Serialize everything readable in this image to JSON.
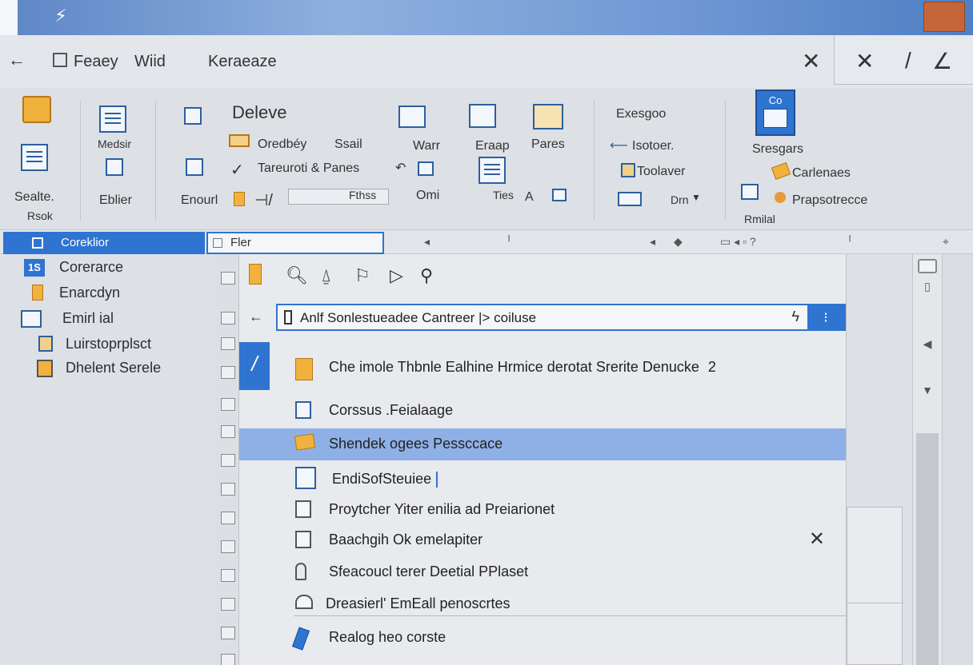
{
  "menu": {
    "items": [
      "Feaey",
      "Wiid",
      "Keraeaze"
    ]
  },
  "ribbon": {
    "group1": {
      "label1": "Sealte.",
      "label2": "Rsok"
    },
    "group2": {
      "label1": "Medsir",
      "label2": "Eblier"
    },
    "group3": {
      "title": "Deleve",
      "row1": "Oredbéy",
      "row1b": "Ssail",
      "row2": "Tareuroti & Panes",
      "row3a": "Enourl",
      "row3b": "Fthss"
    },
    "group4": {
      "labels": [
        "Warr",
        "Eraap",
        "Pares"
      ],
      "row2": "Omi",
      "row3": "Ties"
    },
    "group5": {
      "title": "Exesgoo",
      "row1": "Isotoer.",
      "row2": "Toolaver",
      "row3": "Drn"
    },
    "group6": {
      "tile_caption": "Co",
      "label1": "Sresgars",
      "row2": "Carlenaes",
      "row3": "Prapsotrecce",
      "row4": "Rmilal"
    }
  },
  "tabline": {
    "active_tab": "Coreklior",
    "input_value": "Fler"
  },
  "tree": {
    "items": [
      {
        "label": "Corerarce"
      },
      {
        "label": "Enarcdyn"
      },
      {
        "label": "Emirl ial"
      },
      {
        "label": "Luirstoprplsct"
      },
      {
        "label": "Dhelent Serele"
      }
    ]
  },
  "panel": {
    "search_value": "Anlf Sonlestueadee Cantreer",
    "search_suffix": "coiluse",
    "rows": [
      {
        "label": "Che imole Thbnle Ealhine Hrmice derotat Srerite Denucke",
        "suffix": "2"
      },
      {
        "label": "Corssus .Feialaage"
      },
      {
        "label": "Shendek ogees Pessccace"
      },
      {
        "label": "EndiSofSteuiee"
      },
      {
        "label": "Proytcher Yiter enilia ad Preiarionet"
      },
      {
        "label": "Baachgih Ok emelapiter"
      },
      {
        "label": "Sfeacoucl terer Deetial PPlaset"
      },
      {
        "label": "Dreasierl' EmEall penoscrtes"
      },
      {
        "label": "Realog heo corste"
      }
    ]
  },
  "colors": {
    "accent": "#2f74d0",
    "selection": "#8fb0e6",
    "folder": "#f0b23c",
    "titlebar": "#6f98d4",
    "close": "#c4663a"
  }
}
